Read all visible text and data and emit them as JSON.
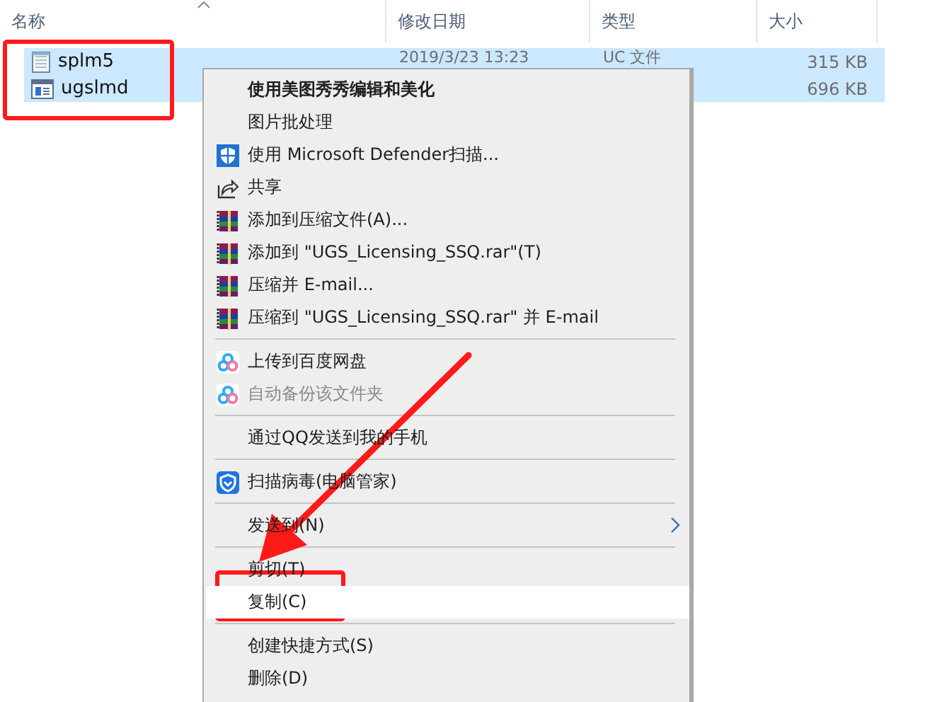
{
  "file_list": {
    "columns": [
      {
        "label": "名称",
        "sorted": true
      },
      {
        "label": "修改日期",
        "sorted": false
      },
      {
        "label": "类型",
        "sorted": false
      },
      {
        "label": "大小",
        "sorted": false
      }
    ],
    "rows": [
      {
        "name": "splm5",
        "kind": "document",
        "date": "2019/3/23 13:23",
        "type": "UC 文件",
        "size": "315 KB",
        "selected": true
      },
      {
        "name": "ugslmd",
        "kind": "program",
        "size": "696 KB",
        "selected": true
      }
    ]
  },
  "context_menu": {
    "items": [
      {
        "kind": "plain",
        "label": "使用美图秀秀编辑和美化",
        "bold": true
      },
      {
        "kind": "plain",
        "label": "图片批处理"
      },
      {
        "kind": "defender",
        "label": "使用 Microsoft Defender扫描..."
      },
      {
        "kind": "share",
        "label": "共享"
      },
      {
        "kind": "archive",
        "label": "添加到压缩文件(A)..."
      },
      {
        "kind": "archive",
        "label": "添加到 \"UGS_Licensing_SSQ.rar\"(T)"
      },
      {
        "kind": "archive",
        "label": "压缩并 E-mail..."
      },
      {
        "kind": "archive",
        "label": "压缩到 \"UGS_Licensing_SSQ.rar\" 并 E-mail"
      },
      {
        "kind": "separator"
      },
      {
        "kind": "cloud",
        "label": "上传到百度网盘"
      },
      {
        "kind": "cloud",
        "label": "自动备份该文件夹",
        "disabled": true
      },
      {
        "kind": "separator"
      },
      {
        "kind": "plain",
        "label": "通过QQ发送到我的手机"
      },
      {
        "kind": "separator"
      },
      {
        "kind": "guard",
        "label": "扫描病毒(电脑管家)"
      },
      {
        "kind": "separator"
      },
      {
        "kind": "plain",
        "label": "发送到(N)",
        "submenu": true
      },
      {
        "kind": "separator"
      },
      {
        "kind": "plain",
        "label": "剪切(T)"
      },
      {
        "kind": "plain",
        "label": "复制(C)",
        "highlighted": true
      },
      {
        "kind": "separator"
      },
      {
        "kind": "plain",
        "label": "创建快捷方式(S)"
      },
      {
        "kind": "plain",
        "label": "删除(D)"
      }
    ]
  },
  "annotations": [
    {
      "kind": "box"
    },
    {
      "kind": "box"
    },
    {
      "kind": "arrow"
    }
  ]
}
